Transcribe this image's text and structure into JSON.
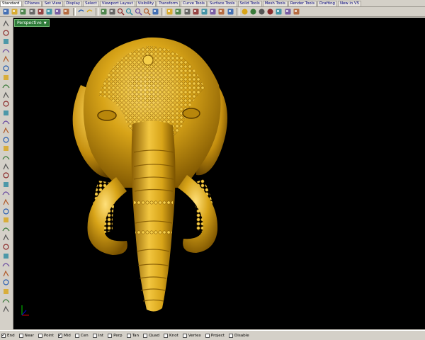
{
  "tabs": [
    {
      "label": "Standard",
      "active": true
    },
    {
      "label": "CPlanes"
    },
    {
      "label": "Set View"
    },
    {
      "label": "Display"
    },
    {
      "label": "Select"
    },
    {
      "label": "Viewport Layout"
    },
    {
      "label": "Visibility"
    },
    {
      "label": "Transform"
    },
    {
      "label": "Curve Tools"
    },
    {
      "label": "Surface Tools"
    },
    {
      "label": "Solid Tools"
    },
    {
      "label": "Mesh Tools"
    },
    {
      "label": "Render Tools"
    },
    {
      "label": "Drafting"
    },
    {
      "label": "New in V5"
    }
  ],
  "toolbar_icons": [
    "new-icon",
    "open-icon",
    "save-icon",
    "print-icon",
    "import-icon",
    "cut-icon",
    "copy-icon",
    "paste-icon",
    "undo-icon",
    "redo-icon",
    "pan-icon",
    "rotate-view-icon",
    "zoom-dynamic-icon",
    "zoom-window-icon",
    "zoom-extents-icon",
    "zoom-selected-icon",
    "viewport-layout-icon",
    "grid-icon",
    "points-on-icon",
    "select-all-icon",
    "show-objects-icon",
    "lock-icon",
    "layer-icon",
    "properties-icon",
    "color-icon",
    "render-sphere-icon",
    "wireframe-sphere-icon",
    "shaded-sphere-icon",
    "material-sphere-icon",
    "lights-icon",
    "options-icon",
    "help-icon"
  ],
  "left_tools": [
    "select-icon",
    "point-icon",
    "polyline-icon",
    "curve-icon",
    "circle-icon",
    "arc-icon",
    "ellipse-icon",
    "rectangle-icon",
    "polygon-icon",
    "free-curve-icon",
    "surface-icon",
    "extrude-icon",
    "box-solid-icon",
    "sphere-icon",
    "mesh-icon",
    "plane-icon",
    "text-icon",
    "fillet-icon",
    "trim-icon",
    "split-icon",
    "join-icon",
    "explode-icon",
    "move-icon",
    "copy-object-icon",
    "rotate-icon",
    "scale-icon",
    "mirror-icon",
    "array-icon",
    "dimension-icon",
    "group-icon",
    "block-icon",
    "analyze-icon",
    "render-icon"
  ],
  "viewport": {
    "label": "Perspective",
    "background": "#000000",
    "model_color": "#d4a016"
  },
  "osnaps": [
    {
      "label": "End",
      "checked": true
    },
    {
      "label": "Near",
      "checked": false
    },
    {
      "label": "Point",
      "checked": false
    },
    {
      "label": "Mid",
      "checked": true
    },
    {
      "label": "Cen",
      "checked": false
    },
    {
      "label": "Int",
      "checked": false
    },
    {
      "label": "Perp",
      "checked": false
    },
    {
      "label": "Tan",
      "checked": false
    },
    {
      "label": "Quad",
      "checked": false
    },
    {
      "label": "Knot",
      "checked": false
    },
    {
      "label": "Vertex",
      "checked": false
    },
    {
      "label": "Project",
      "checked": false
    },
    {
      "label": "Disable",
      "checked": false
    }
  ]
}
